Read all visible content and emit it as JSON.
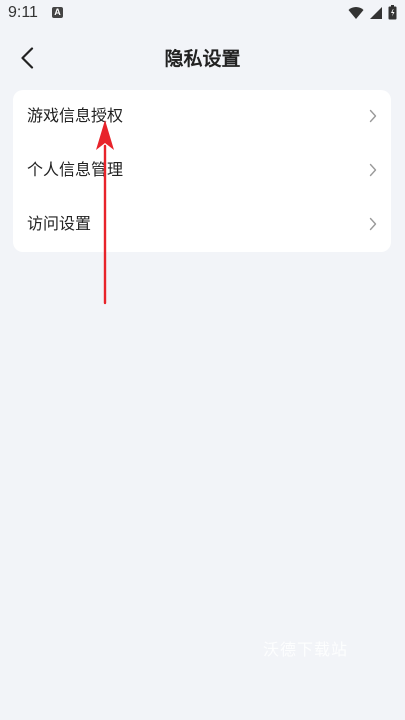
{
  "status_bar": {
    "time": "9:11",
    "a_badge": "A",
    "icons": [
      "wifi-icon",
      "signal-icon",
      "battery-icon"
    ]
  },
  "header": {
    "title": "隐私设置",
    "back_icon": "chevron-left-icon"
  },
  "settings": {
    "items": [
      {
        "label": "游戏信息授权",
        "icon": "chevron-right-icon"
      },
      {
        "label": "个人信息管理",
        "icon": "chevron-right-icon"
      },
      {
        "label": "访问设置",
        "icon": "chevron-right-icon"
      }
    ]
  },
  "annotation": {
    "arrow_color": "#e8232a"
  },
  "watermark": {
    "text": "沃德下载站"
  },
  "colors": {
    "background": "#f2f4f8",
    "card": "#ffffff",
    "chevron": "#9a9a9a"
  }
}
